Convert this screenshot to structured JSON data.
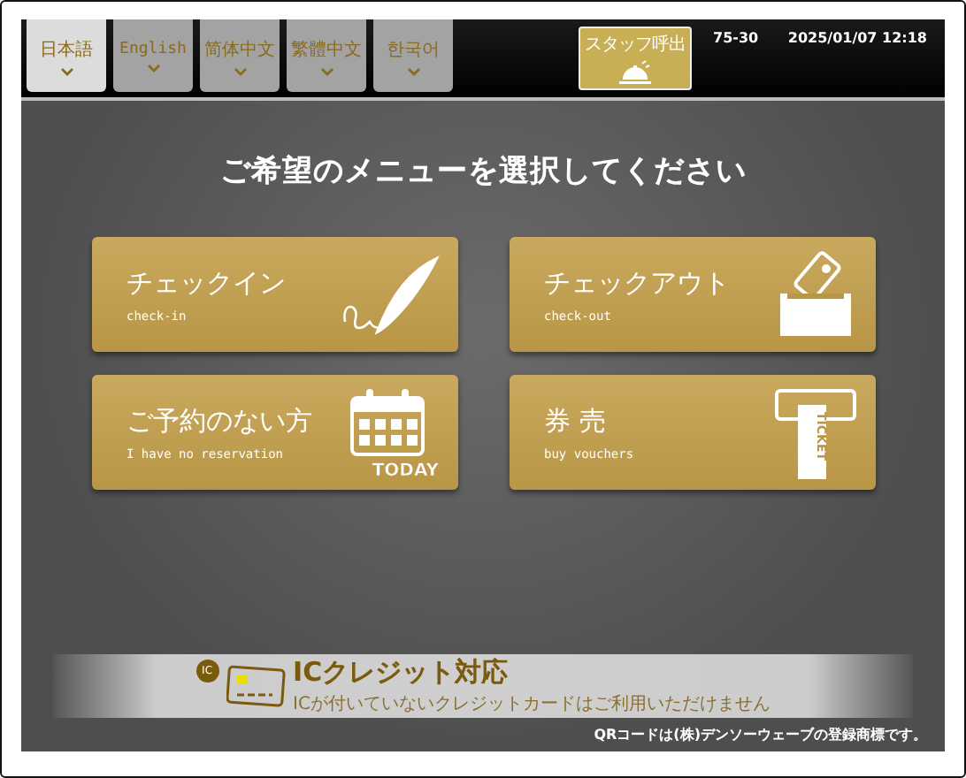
{
  "language_tabs": [
    {
      "label": "日本語",
      "selected": true
    },
    {
      "label": "English",
      "selected": false
    },
    {
      "label": "简体中文",
      "selected": false
    },
    {
      "label": "繁體中文",
      "selected": false
    },
    {
      "label": "한국어",
      "selected": false
    }
  ],
  "staff_call_button": {
    "label": "スタッフ呼出"
  },
  "terminal_id": "75-30",
  "datetime": "2025/01/07 12:18",
  "heading": "ご希望のメニューを選択してください",
  "menu": [
    {
      "kind": "checkin",
      "title": "チェックイン",
      "subtitle": "check-in"
    },
    {
      "kind": "checkout",
      "title": "チェックアウト",
      "subtitle": "check-out"
    },
    {
      "kind": "walkin",
      "title": "ご予約のない方",
      "subtitle": "I have no reservation",
      "icon_text": "TODAY"
    },
    {
      "kind": "voucher",
      "title": "券 売",
      "subtitle": "buy vouchers",
      "icon_text": "TICKET"
    }
  ],
  "ic_banner": {
    "badge": "IC",
    "title": "ICクレジット対応",
    "note": "ICが付いていないクレジットカードはご利用いただけません"
  },
  "footer_note": "QRコードは(株)デンソーウェーブの登録商標です。"
}
